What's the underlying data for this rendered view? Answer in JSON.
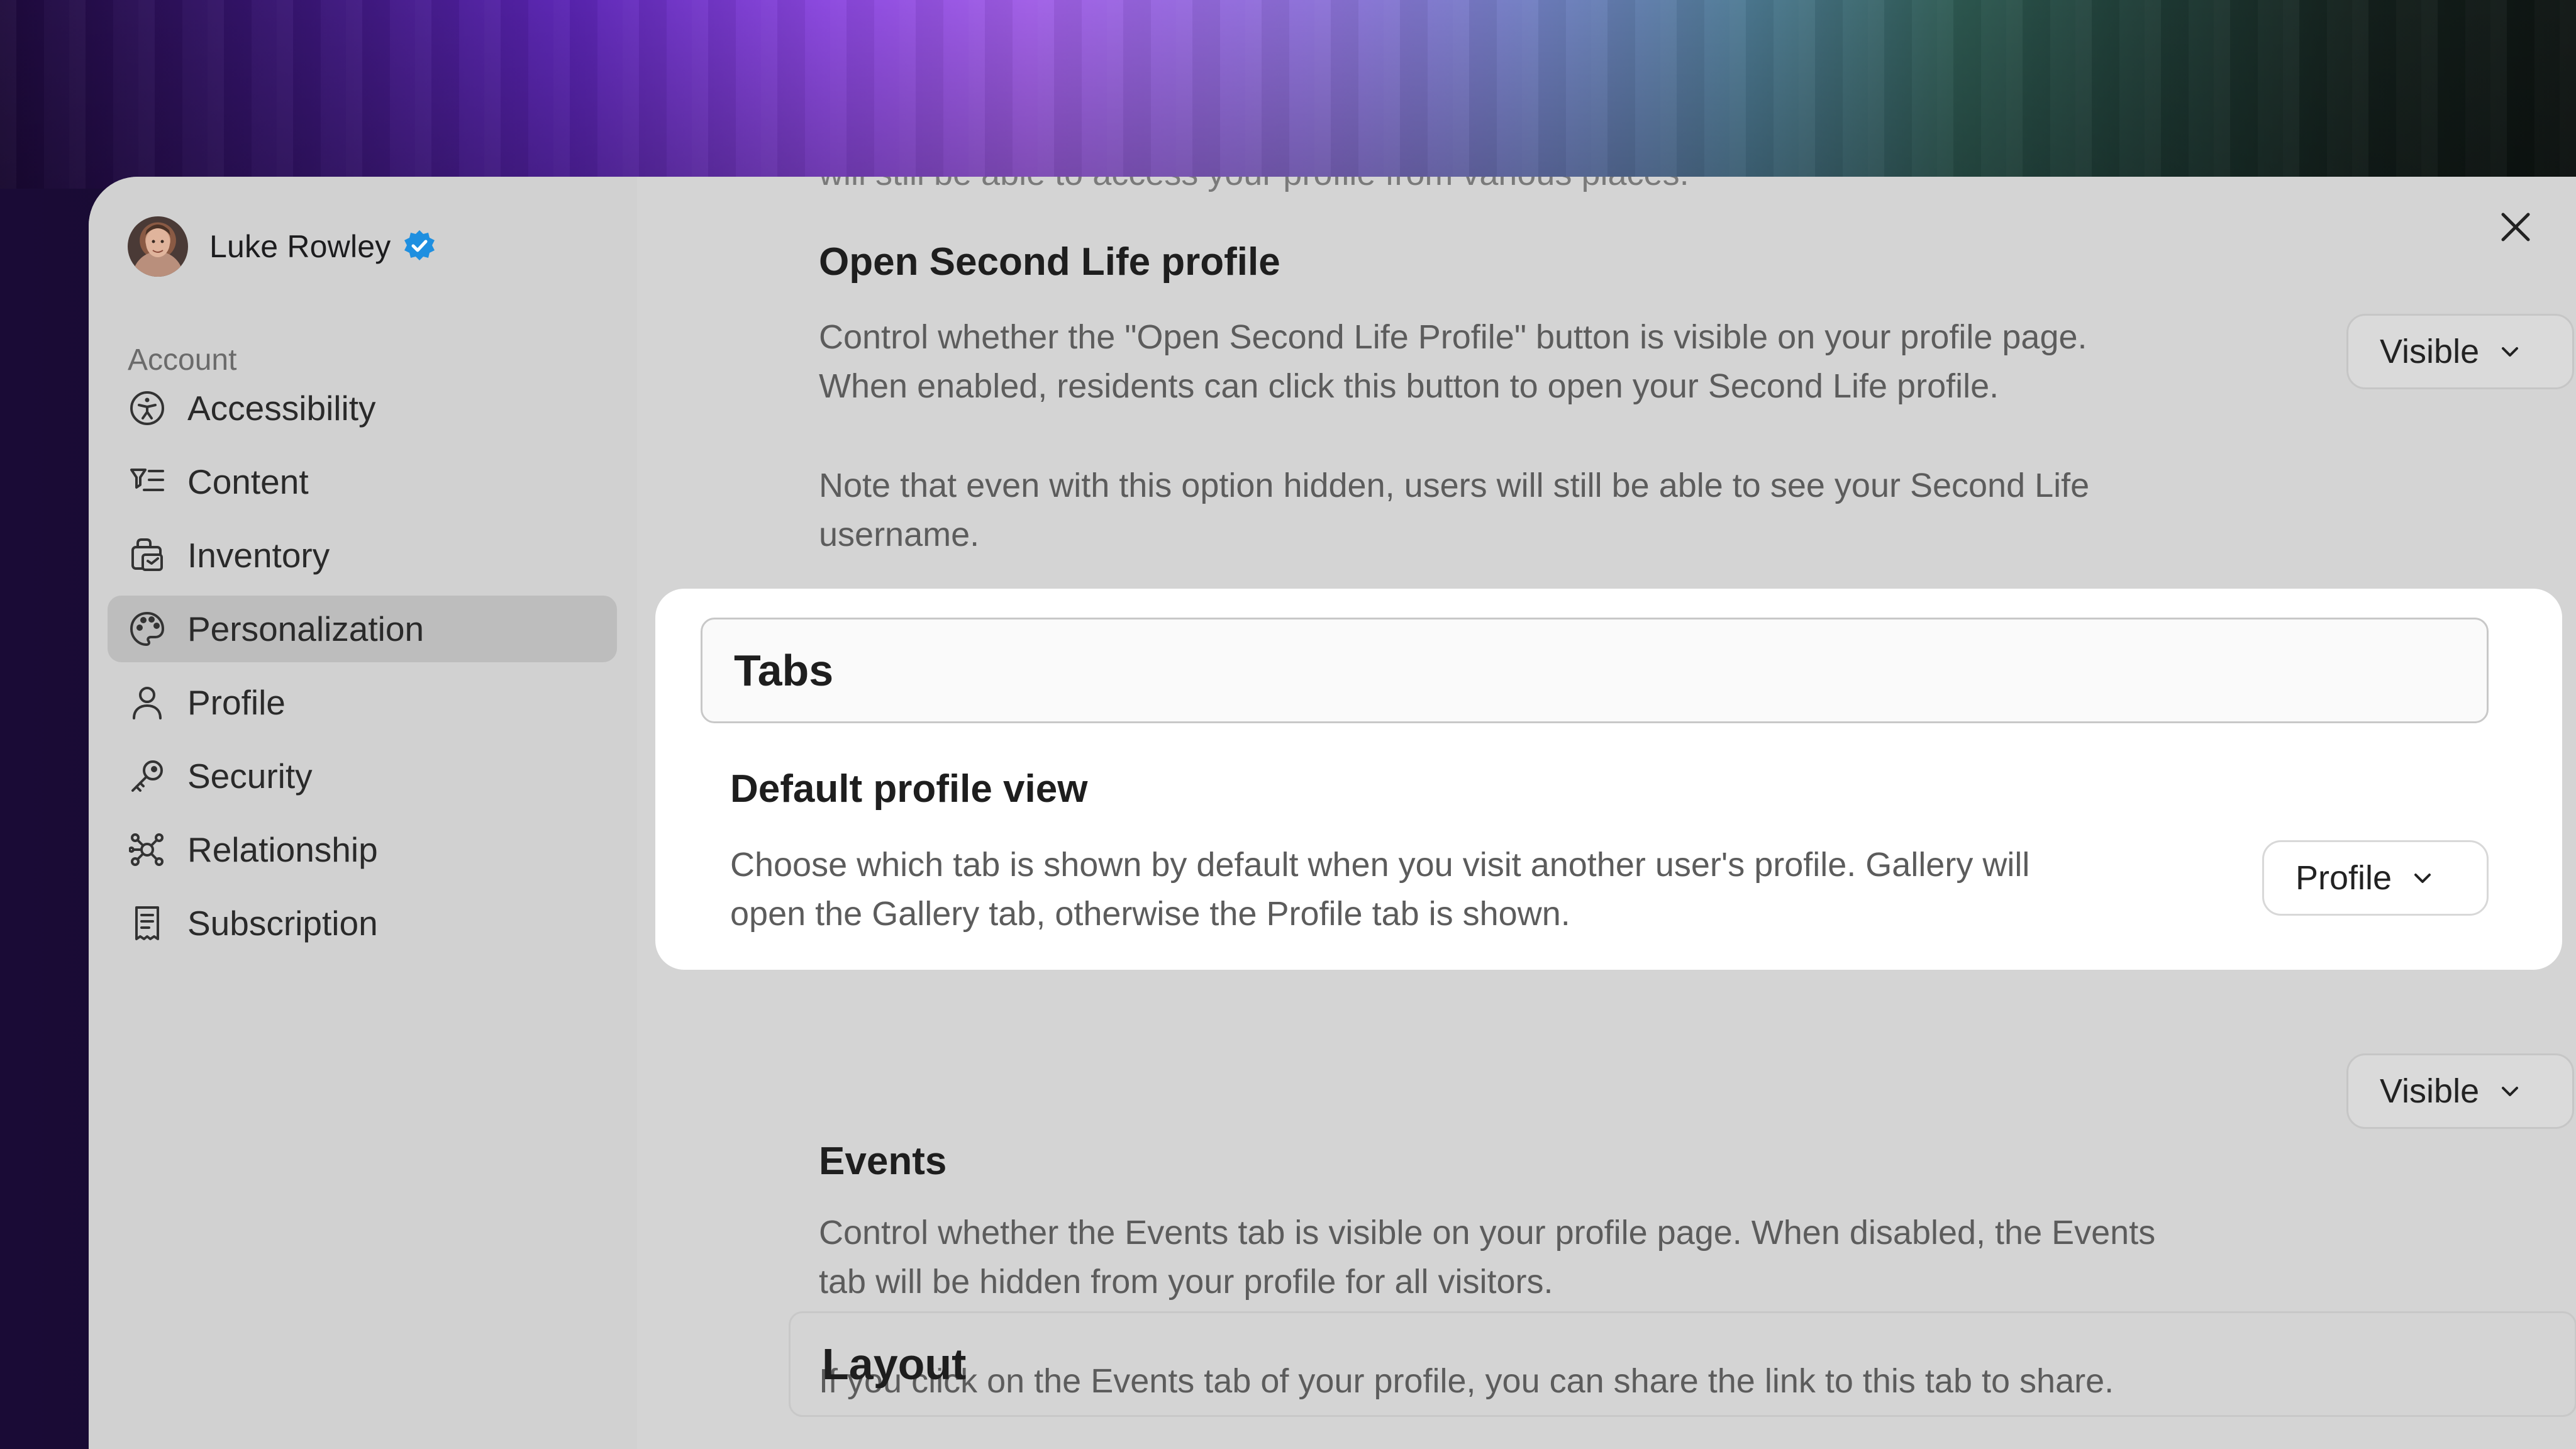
{
  "user": {
    "name": "Luke Rowley"
  },
  "sidebar": {
    "section_label": "Account",
    "items": [
      {
        "label": "Accessibility",
        "icon": "accessibility-icon"
      },
      {
        "label": "Content",
        "icon": "filter-list-icon"
      },
      {
        "label": "Inventory",
        "icon": "inventory-bag-icon"
      },
      {
        "label": "Personalization",
        "icon": "palette-icon",
        "active": true
      },
      {
        "label": "Profile",
        "icon": "person-icon"
      },
      {
        "label": "Security",
        "icon": "key-icon"
      },
      {
        "label": "Relationship",
        "icon": "network-icon"
      },
      {
        "label": "Subscription",
        "icon": "receipt-icon"
      }
    ]
  },
  "content": {
    "cut_text": "will still be able to access your profile from various places.",
    "open_sl": {
      "title": "Open Second Life profile",
      "desc_line1": "Control whether the \"Open Second Life Profile\" button is visible on your profile page.",
      "desc_line2": "When enabled, residents can click this button to open your Second Life profile.",
      "note_line1": "Note that even with this option hidden, users will still be able to see your Second Life",
      "note_line2": "username.",
      "value": "Visible"
    },
    "tabs_header": "Tabs",
    "default_view": {
      "title": "Default profile view",
      "desc_line1": "Choose which tab is shown by default when you visit another user's profile. Gallery will",
      "desc_line2": "open the Gallery tab, otherwise the Profile tab is shown.",
      "value": "Profile"
    },
    "events": {
      "title": "Events",
      "desc_line1": "Control whether the Events tab is visible on your profile page. When disabled, the Events",
      "desc_line2": "tab will be hidden from your profile for all visitors.",
      "note": "If you click on the Events tab of your profile, you can share the link to this tab to share.",
      "value": "Visible"
    },
    "layout_header": "Layout"
  },
  "colors": {
    "window_bg": "#d4d4d4",
    "sidebar_active": "#bdbdbd",
    "highlight": "#ffffff",
    "verified": "#1e8fe0"
  }
}
